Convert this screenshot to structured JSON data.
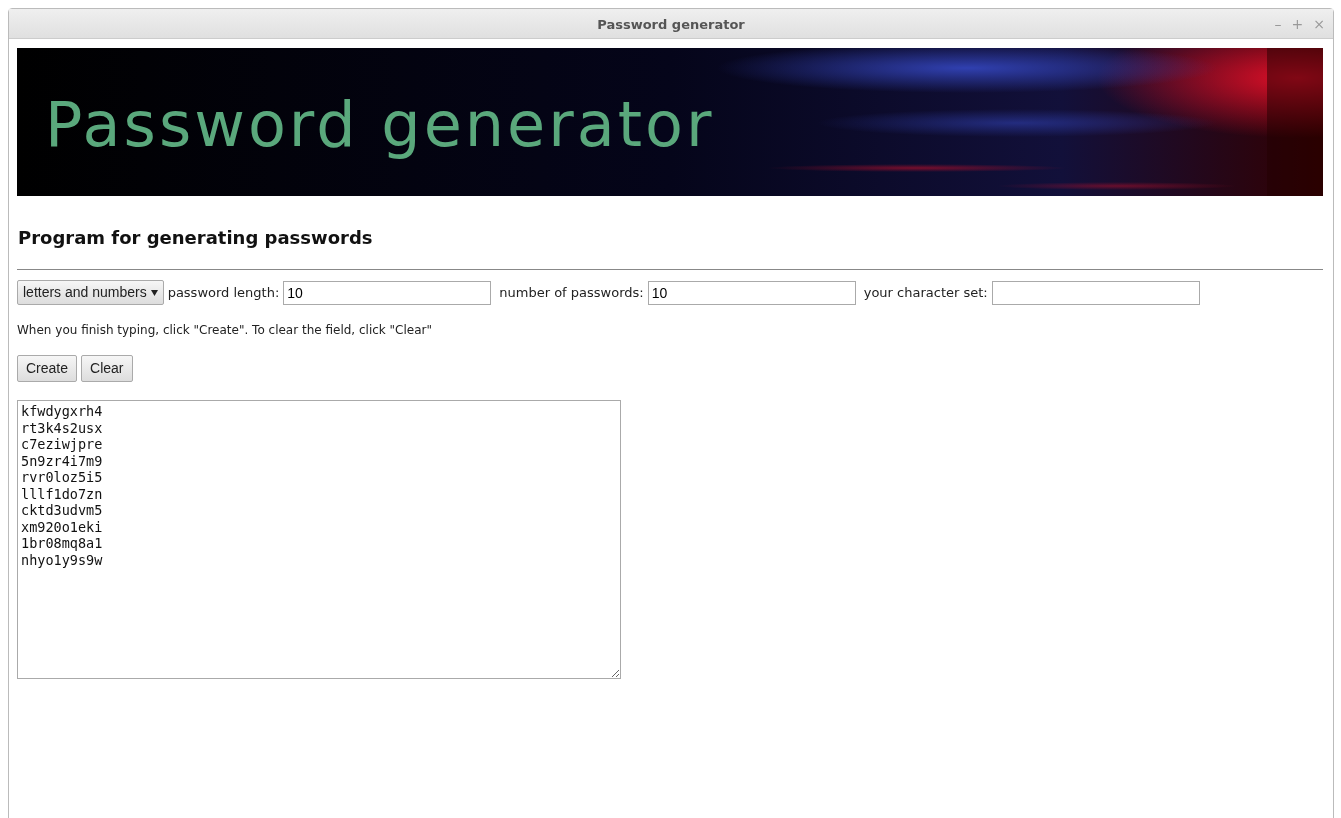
{
  "window": {
    "title": "Password generator",
    "controls": [
      "–",
      "+",
      "×"
    ]
  },
  "banner": {
    "title": "Password generator"
  },
  "heading": "Program for generating passwords",
  "form": {
    "mode": "letters and numbers",
    "length_label": "password length:",
    "length_value": "10",
    "count_label": "number of passwords:",
    "count_value": "10",
    "charset_label": "your character set:"
  },
  "hint": "When you finish typing, click \"Create\". To clear the field, click \"Clear\"",
  "buttons": [
    "Create",
    "Clear"
  ],
  "output": [
    "kfwdygxrh4",
    "rt3k4s2usx",
    "c7eziwjpre",
    "5n9zr4i7m9",
    "rvr0loz5i5",
    "lllf1do7zn",
    "cktd3udvm5",
    "xm920o1eki",
    "1br08mq8a1",
    "nhyo1y9s9w"
  ]
}
